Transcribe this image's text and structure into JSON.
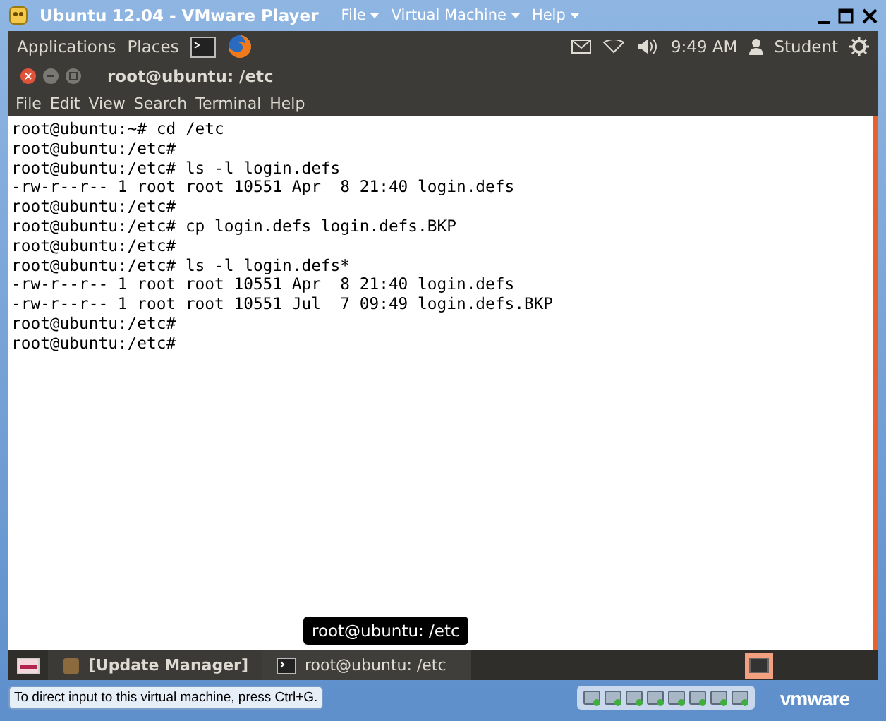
{
  "player": {
    "title": "Ubuntu 12.04 - VMware Player",
    "menus": [
      "File",
      "Virtual Machine",
      "Help"
    ]
  },
  "panel": {
    "menus": [
      "Applications",
      "Places"
    ],
    "clock": "9:49 AM",
    "user": "Student"
  },
  "terminal": {
    "title": "root@ubuntu: /etc",
    "menu": [
      "File",
      "Edit",
      "View",
      "Search",
      "Terminal",
      "Help"
    ],
    "lines": [
      "root@ubuntu:~# cd /etc",
      "root@ubuntu:/etc#",
      "root@ubuntu:/etc# ls -l login.defs",
      "-rw-r--r-- 1 root root 10551 Apr  8 21:40 login.defs",
      "root@ubuntu:/etc#",
      "root@ubuntu:/etc# cp login.defs login.defs.BKP",
      "root@ubuntu:/etc#",
      "root@ubuntu:/etc# ls -l login.defs*",
      "-rw-r--r-- 1 root root 10551 Apr  8 21:40 login.defs",
      "-rw-r--r-- 1 root root 10551 Jul  7 09:49 login.defs.BKP",
      "root@ubuntu:/etc#",
      "root@ubuntu:/etc#"
    ]
  },
  "tooltip": "root@ubuntu: /etc",
  "taskbar": [
    {
      "label": "[Update Manager]",
      "minimized": true
    },
    {
      "label": "root@ubuntu: /etc",
      "minimized": false
    }
  ],
  "status": {
    "message": "To direct input to this virtual machine, press Ctrl+G.",
    "logo": "vmware"
  }
}
